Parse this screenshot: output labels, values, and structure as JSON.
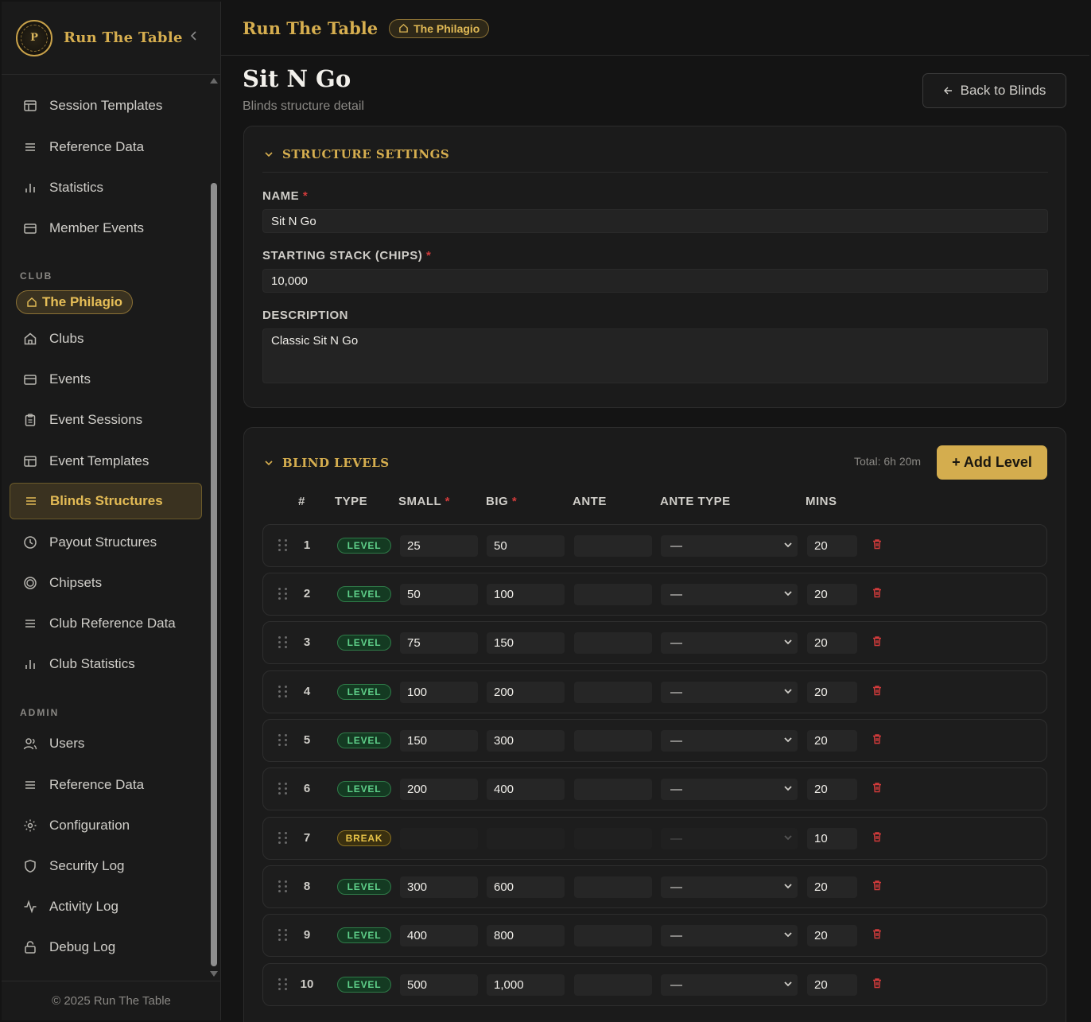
{
  "sidebar": {
    "brand": "Run The Table",
    "logo_letter": "P",
    "top_items": [
      {
        "label": "Session Templates",
        "icon": "layout-icon"
      },
      {
        "label": "Reference Data",
        "icon": "list-icon"
      },
      {
        "label": "Statistics",
        "icon": "bar-chart-icon"
      },
      {
        "label": "Member Events",
        "icon": "calendar-icon"
      }
    ],
    "club_section_label": "CLUB",
    "club_pill": "The Philagio",
    "club_items": [
      {
        "label": "Clubs",
        "icon": "home-icon"
      },
      {
        "label": "Events",
        "icon": "calendar-icon"
      },
      {
        "label": "Event Sessions",
        "icon": "clipboard-icon"
      },
      {
        "label": "Event Templates",
        "icon": "layout-icon"
      },
      {
        "label": "Blinds Structures",
        "icon": "list-icon",
        "active": true
      },
      {
        "label": "Payout Structures",
        "icon": "clock-icon"
      },
      {
        "label": "Chipsets",
        "icon": "chip-icon"
      },
      {
        "label": "Club Reference Data",
        "icon": "list-icon"
      },
      {
        "label": "Club Statistics",
        "icon": "bar-chart-icon"
      }
    ],
    "admin_section_label": "ADMIN",
    "admin_items": [
      {
        "label": "Users",
        "icon": "users-icon"
      },
      {
        "label": "Reference Data",
        "icon": "list-icon"
      },
      {
        "label": "Configuration",
        "icon": "gear-icon"
      },
      {
        "label": "Security Log",
        "icon": "shield-icon"
      },
      {
        "label": "Activity Log",
        "icon": "activity-icon"
      },
      {
        "label": "Debug Log",
        "icon": "lock-icon"
      }
    ],
    "footer": "© 2025 Run The Table"
  },
  "topbar": {
    "title": "Run The Table",
    "club_pill": "The Philagio"
  },
  "page": {
    "title": "Sit N Go",
    "subtitle": "Blinds structure detail",
    "back_button": "Back to Blinds"
  },
  "settings": {
    "heading": "STRUCTURE SETTINGS",
    "name_label": "NAME",
    "name_value": "Sit N Go",
    "stack_label": "STARTING STACK (CHIPS)",
    "stack_value": "10,000",
    "description_label": "DESCRIPTION",
    "description_value": "Classic Sit N Go",
    "required_mark": "*"
  },
  "levels": {
    "heading": "BLIND LEVELS",
    "total": "Total: 6h 20m",
    "add_button": "+ Add Level",
    "columns": {
      "num": "#",
      "type": "TYPE",
      "small": "SMALL",
      "big": "BIG",
      "ante": "ANTE",
      "ante_type": "ANTE TYPE",
      "mins": "MINS"
    },
    "rows": [
      {
        "num": "1",
        "type": "LEVEL",
        "small": "25",
        "big": "50",
        "ante": "",
        "ante_type": "—",
        "mins": "20"
      },
      {
        "num": "2",
        "type": "LEVEL",
        "small": "50",
        "big": "100",
        "ante": "",
        "ante_type": "—",
        "mins": "20"
      },
      {
        "num": "3",
        "type": "LEVEL",
        "small": "75",
        "big": "150",
        "ante": "",
        "ante_type": "—",
        "mins": "20"
      },
      {
        "num": "4",
        "type": "LEVEL",
        "small": "100",
        "big": "200",
        "ante": "",
        "ante_type": "—",
        "mins": "20"
      },
      {
        "num": "5",
        "type": "LEVEL",
        "small": "150",
        "big": "300",
        "ante": "",
        "ante_type": "—",
        "mins": "20"
      },
      {
        "num": "6",
        "type": "LEVEL",
        "small": "200",
        "big": "400",
        "ante": "",
        "ante_type": "—",
        "mins": "20"
      },
      {
        "num": "7",
        "type": "BREAK",
        "small": "",
        "big": "",
        "ante": "",
        "ante_type": "—",
        "mins": "10"
      },
      {
        "num": "8",
        "type": "LEVEL",
        "small": "300",
        "big": "600",
        "ante": "",
        "ante_type": "—",
        "mins": "20"
      },
      {
        "num": "9",
        "type": "LEVEL",
        "small": "400",
        "big": "800",
        "ante": "",
        "ante_type": "—",
        "mins": "20"
      },
      {
        "num": "10",
        "type": "LEVEL",
        "small": "500",
        "big": "1,000",
        "ante": "",
        "ante_type": "—",
        "mins": "20"
      }
    ]
  },
  "colors": {
    "accent": "#d6ae4f",
    "danger": "#d23b3b",
    "level_green": "#5fd08a"
  }
}
